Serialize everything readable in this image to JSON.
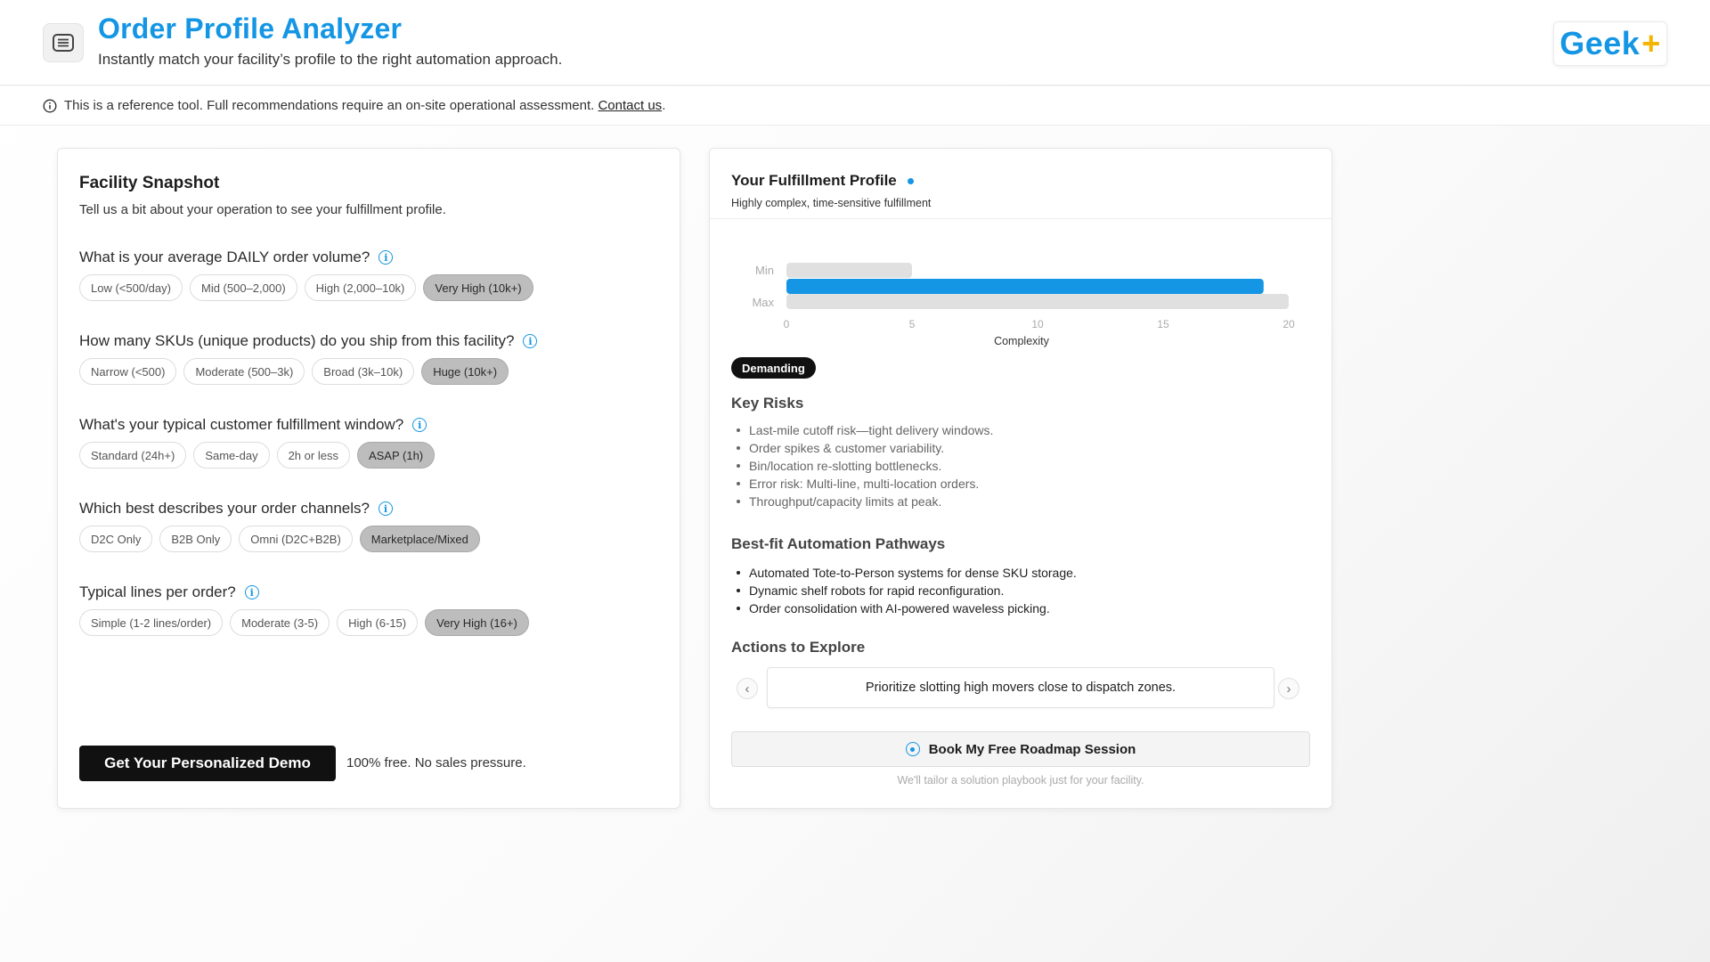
{
  "header": {
    "title": "Order Profile Analyzer",
    "subtitle": "Instantly match your facility’s profile to the right automation approach.",
    "logo_text": "Geek",
    "logo_plus": "+",
    "accent_color": "#1496e4"
  },
  "notice": {
    "text": "This is a reference tool. Full recommendations require an on-site operational assessment.",
    "link_text": "Contact us",
    "period": "."
  },
  "snapshot": {
    "title": "Facility Snapshot",
    "subtitle": "Tell us a bit about your operation to see your fulfillment profile.",
    "questions": [
      {
        "label": "What is your average DAILY order volume?",
        "options": [
          "Low (<500/day)",
          "Mid (500–2,000)",
          "High (2,000–10k)",
          "Very High (10k+)"
        ],
        "selected": "Very High (10k+)"
      },
      {
        "label": "How many SKUs (unique products) do you ship from this facility?",
        "options": [
          "Narrow (<500)",
          "Moderate (500–3k)",
          "Broad (3k–10k)",
          "Huge (10k+)"
        ],
        "selected": "Huge (10k+)"
      },
      {
        "label": "What's your typical customer fulfillment window?",
        "options": [
          "Standard (24h+)",
          "Same-day",
          "2h or less",
          "ASAP (1h)"
        ],
        "selected": "ASAP (1h)"
      },
      {
        "label": "Which best describes your order channels?",
        "options": [
          "D2C Only",
          "B2B Only",
          "Omni (D2C+B2B)",
          "Marketplace/Mixed"
        ],
        "selected": "Marketplace/Mixed"
      },
      {
        "label": "Typical lines per order?",
        "options": [
          "Simple (1-2 lines/order)",
          "Moderate (3-5)",
          "High (6-15)",
          "Very High (16+)"
        ],
        "selected": "Very High (16+)"
      }
    ],
    "cta_label": "Get Your Personalized Demo",
    "cta_note": "100% free. No sales pressure."
  },
  "profile": {
    "title": "Your Fulfillment Profile",
    "subtitle": "Highly complex, time-sensitive fulfillment",
    "badge": "Demanding",
    "risks_title": "Key Risks",
    "risks": [
      "Last-mile cutoff risk—tight delivery windows.",
      "Order spikes & customer variability.",
      "Bin/location re-slotting bottlenecks.",
      "Error risk: Multi-line, multi-location orders.",
      "Throughput/capacity limits at peak."
    ],
    "pathways_title": "Best-fit Automation Pathways",
    "pathways": [
      "Automated Tote-to-Person systems for dense SKU storage.",
      "Dynamic shelf robots for rapid reconfiguration.",
      "Order consolidation with AI-powered waveless picking."
    ],
    "actions_title": "Actions to Explore",
    "action_text": "Prioritize slotting high movers close to dispatch zones.",
    "book_label": "Book My Free Roadmap Session",
    "book_note": "We'll tailor a solution playbook just for your facility."
  },
  "chart_data": {
    "type": "bar",
    "orientation": "horizontal",
    "categories": [
      "Min",
      "",
      "Max"
    ],
    "values": [
      5,
      19,
      20
    ],
    "colors": [
      "#e0e0e0",
      "#1496e4",
      "#e0e0e0"
    ],
    "xlabel": "Complexity",
    "xlim": [
      0,
      20
    ],
    "xticks": [
      0,
      5,
      10,
      15,
      20
    ],
    "grid": false
  }
}
